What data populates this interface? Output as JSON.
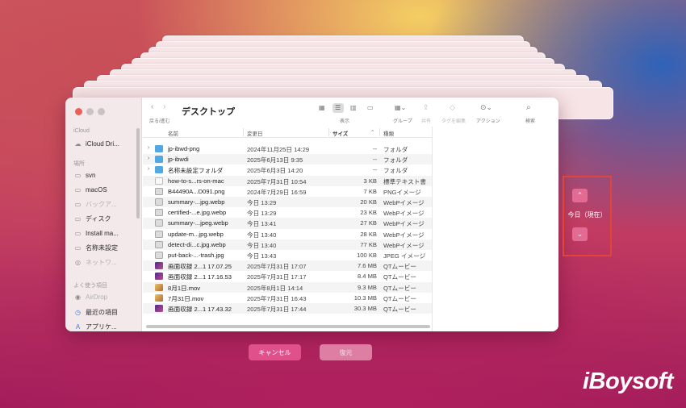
{
  "finder": {
    "title": "デスクトップ",
    "toolbar": {
      "back_forward_label": "戻る/進む",
      "view_label": "表示",
      "group_label": "グループ",
      "share_label": "共有",
      "tag_label": "タグを編集",
      "action_label": "アクション",
      "search_label": "検索"
    },
    "sidebar": {
      "icloud_header": "iCloud",
      "icloud_drive": "iCloud Dri...",
      "locations_header": "場所",
      "svn": "svn",
      "macos": "macOS",
      "backup": "バックア...",
      "disk": "ディスク",
      "install": "Install ma...",
      "untitled": "名称未設定",
      "network": "ネットワ...",
      "favorites_header": "よく使う項目",
      "airdrop": "AirDrop",
      "recent": "最近の項目",
      "applications": "アプリケ..."
    },
    "columns": {
      "name": "名前",
      "date": "変更日",
      "size": "サイズ",
      "kind": "種類"
    },
    "files": [
      {
        "name": "jp-ibwd-png",
        "date": "2024年11月25日 14:29",
        "size": "--",
        "kind": "フォルダ",
        "icon": "folder-icon"
      },
      {
        "name": "jp-ibwdi",
        "date": "2025年6月13日 9:35",
        "size": "--",
        "kind": "フォルダ",
        "icon": "folder-icon"
      },
      {
        "name": "名称未設定フォルダ",
        "date": "2025年6月3日 14:20",
        "size": "--",
        "kind": "フォルダ",
        "icon": "folder-icon"
      },
      {
        "name": "how-to-s...rs-on-mac",
        "date": "2025年7月31日 10:54",
        "size": "3 KB",
        "kind": "標準テキスト書",
        "icon": "text-file-icon"
      },
      {
        "name": "B44490A...D091.png",
        "date": "2024年7月29日 16:59",
        "size": "7 KB",
        "kind": "PNGイメージ",
        "icon": "image-file-icon"
      },
      {
        "name": "summary-...jpg.webp",
        "date": "今日 13:29",
        "size": "20 KB",
        "kind": "WebPイメージ",
        "icon": "image-file-icon"
      },
      {
        "name": "certified-...e.jpg.webp",
        "date": "今日 13:29",
        "size": "23 KB",
        "kind": "WebPイメージ",
        "icon": "image-file-icon"
      },
      {
        "name": "summary-...jpeg.webp",
        "date": "今日 13:41",
        "size": "27 KB",
        "kind": "WebPイメージ",
        "icon": "image-file-icon"
      },
      {
        "name": "update-m...jpg.webp",
        "date": "今日 13:40",
        "size": "28 KB",
        "kind": "WebPイメージ",
        "icon": "image-file-icon"
      },
      {
        "name": "detect-di...c.jpg.webp",
        "date": "今日 13:40",
        "size": "77 KB",
        "kind": "WebPイメージ",
        "icon": "image-file-icon"
      },
      {
        "name": "put-back-...-trash.jpg",
        "date": "今日 13:43",
        "size": "100 KB",
        "kind": "JPEG イメージ",
        "icon": "image-file-icon"
      },
      {
        "name": "画面収録 2...1 17.07.25",
        "date": "2025年7月31日 17:07",
        "size": "7.6 MB",
        "kind": "QTムービー",
        "icon": "video-file-icon"
      },
      {
        "name": "画面収録 2...1 17.16.53",
        "date": "2025年7月31日 17:17",
        "size": "8.4 MB",
        "kind": "QTムービー",
        "icon": "video-file-icon"
      },
      {
        "name": "8月1日.mov",
        "date": "2025年8月1日 14:14",
        "size": "9.3 MB",
        "kind": "QTムービー",
        "icon": "movie-file-icon"
      },
      {
        "name": "7月31日.mov",
        "date": "2025年7月31日 16:43",
        "size": "10.3 MB",
        "kind": "QTムービー",
        "icon": "movie-file-icon"
      },
      {
        "name": "画面収録 2...1 17.43.32",
        "date": "2025年7月31日 17:44",
        "size": "30.3 MB",
        "kind": "QTムービー",
        "icon": "video-file-icon"
      }
    ]
  },
  "buttons": {
    "cancel": "キャンセル",
    "restore": "復元"
  },
  "timeline": {
    "current_label": "今日（現在）",
    "up": "⌃",
    "down": "⌄"
  },
  "logo_text": "iBoysoft",
  "colors": {
    "accent": "#e0508a",
    "highlight_box": "#e14438",
    "folder": "#52a8e3"
  }
}
